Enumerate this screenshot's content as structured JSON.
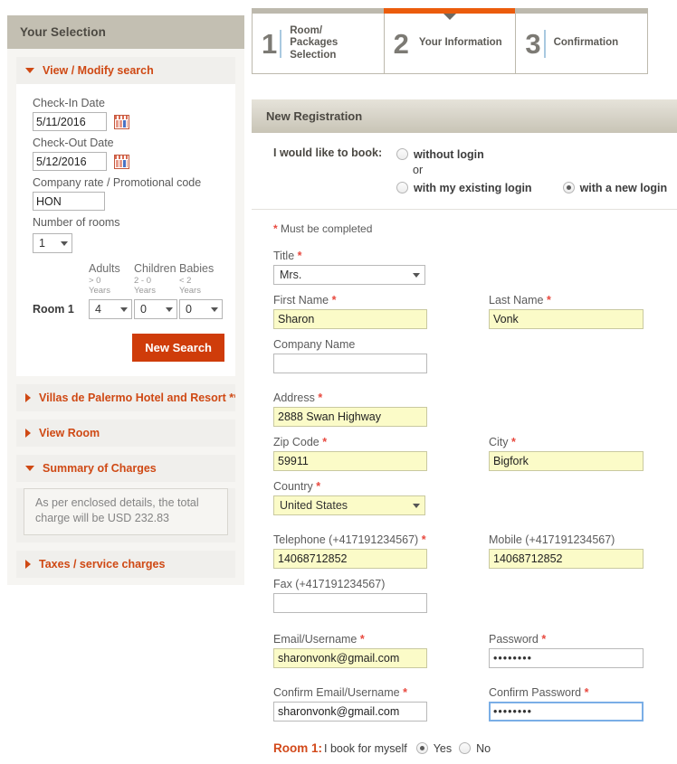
{
  "sidebar": {
    "title": "Your Selection",
    "sections": {
      "view_modify": {
        "label": "View / Modify search",
        "expanded": true,
        "checkin_label": "Check-In Date",
        "checkin_value": "5/11/2016",
        "checkout_label": "Check-Out Date",
        "checkout_value": "5/12/2016",
        "promo_label": "Company rate / Promotional code",
        "promo_value": "HON",
        "rooms_label": "Number of rooms",
        "rooms_value": "1",
        "occupancy": {
          "head_adults": "Adults",
          "head_children": "Children",
          "head_babies": "Babies",
          "sub_adults": "> 0\nYears",
          "sub_adults_l1": "> 0",
          "sub_adults_l2": "Years",
          "sub_children_l1": "2 - 0",
          "sub_children_l2": "Years",
          "sub_babies_l1": "< 2",
          "sub_babies_l2": "Years",
          "row_label": "Room 1",
          "adults_value": "4",
          "children_value": "0",
          "babies_value": "0"
        },
        "new_search_label": "New Search"
      },
      "hotel": {
        "label": "Villas de Palermo Hotel and Resort *****",
        "expanded": false
      },
      "view_room": {
        "label": "View Room",
        "expanded": false
      },
      "summary": {
        "label": "Summary of Charges",
        "expanded": true,
        "text": "As per enclosed details, the total charge will be USD 232.83"
      },
      "taxes": {
        "label": "Taxes / service charges",
        "expanded": false
      }
    }
  },
  "steps": [
    {
      "number": "1",
      "line1": "Room/",
      "line2": "Packages Selection",
      "active": false
    },
    {
      "number": "2",
      "line1": "Your Information",
      "line2": "",
      "active": true
    },
    {
      "number": "3",
      "line1": "Confirmation",
      "line2": "",
      "active": false
    }
  ],
  "registration": {
    "header": "New Registration",
    "book_label": "I would like to book:",
    "opt_without_login": "without login",
    "opt_or": "or",
    "opt_existing_login": "with my existing login",
    "opt_new_login": "with a new login",
    "must_be_completed": "Must be completed",
    "fields": {
      "title_label": "Title",
      "title_value": "Mrs.",
      "first_name_label": "First Name",
      "first_name_value": "Sharon",
      "last_name_label": "Last Name",
      "last_name_value": "Vonk",
      "company_label": "Company Name",
      "company_value": "",
      "address_label": "Address",
      "address_value": "2888 Swan Highway",
      "zip_label": "Zip Code",
      "zip_value": "59911",
      "city_label": "City",
      "city_value": "Bigfork",
      "country_label": "Country",
      "country_value": "United States",
      "telephone_label": "Telephone (+417191234567)",
      "telephone_value": "14068712852",
      "mobile_label": "Mobile (+417191234567)",
      "mobile_value": "14068712852",
      "fax_label": "Fax (+417191234567)",
      "fax_value": "",
      "email_label": "Email/Username",
      "email_value": "sharonvonk@gmail.com",
      "password_label": "Password",
      "password_value": "••••••••",
      "confirm_email_label": "Confirm Email/Username",
      "confirm_email_value": "sharonvonk@gmail.com",
      "confirm_password_label": "Confirm Password",
      "confirm_password_value": "••••••••"
    },
    "room_line": {
      "room_bold": "Room 1:",
      "text": "I book for myself",
      "yes": "Yes",
      "no": "No"
    }
  },
  "colors": {
    "accent_orange": "#cf4914",
    "button_red": "#cf3c0a",
    "active_tab": "#eb5c0c",
    "header_tan": "#c3bfb2",
    "required_star": "#e8493f",
    "filled_field": "#fbfbc8",
    "focus_border": "#7aaee6"
  }
}
